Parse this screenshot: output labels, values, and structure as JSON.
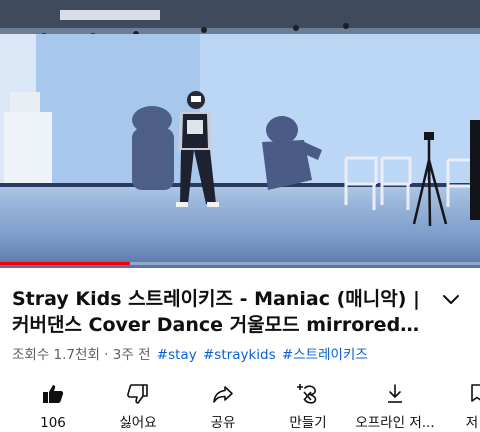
{
  "player": {
    "progress": 0.27
  },
  "video": {
    "title_line1": "Stray Kids 스트레이키즈 - Maniac (매니악) |",
    "title_line2": "커버댄스 Cover Dance 거울모드 mirrored…"
  },
  "meta": {
    "views": "조회수 1.7천회",
    "separator": "·",
    "age": "3주 전",
    "tags": [
      "#stay",
      "#straykids",
      "#스트레이키즈"
    ]
  },
  "actions": {
    "like_count": "106",
    "dislike_label": "싫어요",
    "share_label": "공유",
    "remix_label": "만들기",
    "download_label": "오프라인 저...",
    "save_label": "저"
  },
  "colors": {
    "progress": "#ff0000",
    "link": "#065fd4",
    "text": "#0f0f0f",
    "secondary": "#606060"
  }
}
